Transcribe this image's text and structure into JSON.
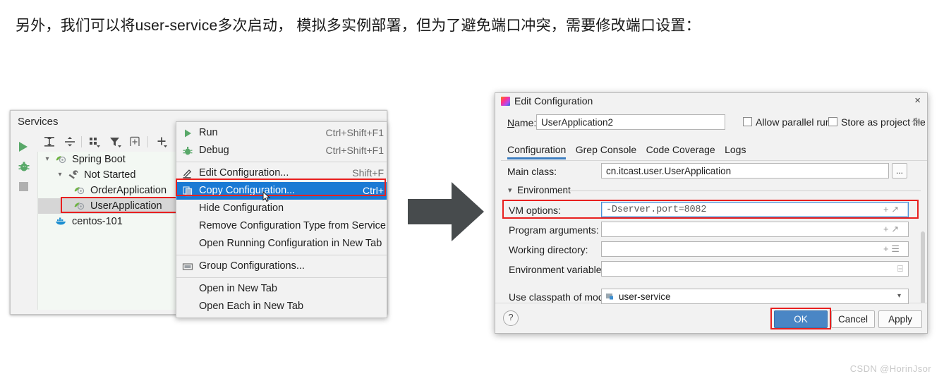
{
  "intro": {
    "text": "另外，我们可以将user-service多次启动， 模拟多实例部署，但为了避免端口冲突，需要修改端口设置："
  },
  "services_panel": {
    "title": "Services",
    "side_toolbar": [
      {
        "name": "run-icon",
        "label": "Run"
      },
      {
        "name": "debug-icon",
        "label": "Debug"
      },
      {
        "name": "stop-icon",
        "label": "Stop"
      }
    ],
    "toolbar": [
      {
        "name": "expand-all-icon",
        "label": "Expand All"
      },
      {
        "name": "collapse-all-icon",
        "label": "Collapse All"
      },
      {
        "name": "group-icon",
        "label": "Group"
      },
      {
        "name": "filter-icon",
        "label": "Filter"
      },
      {
        "name": "new-tab-icon",
        "label": "Open in New Tab"
      },
      {
        "name": "add-icon",
        "label": "Add Service"
      }
    ],
    "tree": [
      {
        "label": "Spring Boot",
        "icon": "spring-leaf-icon",
        "indent": 0,
        "chevron": "v",
        "selected": false
      },
      {
        "label": "Not Started",
        "icon": "wrench-icon",
        "indent": 1,
        "chevron": "v",
        "selected": false
      },
      {
        "label": "OrderApplication",
        "icon": "spring-leaf-icon",
        "indent": 2,
        "chevron": "",
        "selected": false
      },
      {
        "label": "UserApplication",
        "icon": "spring-leaf-icon",
        "indent": 2,
        "chevron": "",
        "selected": true
      },
      {
        "label": "centos-101",
        "icon": "docker-icon",
        "indent": 0,
        "chevron": "",
        "selected": false
      }
    ]
  },
  "context_menu": {
    "items": [
      {
        "label": "Run",
        "shortcut": "Ctrl+Shift+F1",
        "icon": "run-icon",
        "highlight": false,
        "separator_after": false
      },
      {
        "label": "Debug",
        "shortcut": "Ctrl+Shift+F1",
        "icon": "debug-icon",
        "highlight": false,
        "separator_after": true
      },
      {
        "label": "Edit Configuration...",
        "shortcut": "Shift+F",
        "icon": "pencil-icon",
        "highlight": false,
        "separator_after": false
      },
      {
        "label": "Copy Configuration...",
        "shortcut": "Ctrl+",
        "icon": "copy-icon",
        "highlight": true,
        "separator_after": false
      },
      {
        "label": "Hide Configuration",
        "shortcut": "",
        "icon": "",
        "highlight": false,
        "separator_after": false
      },
      {
        "label": "Remove Configuration Type from Service",
        "shortcut": "",
        "icon": "",
        "highlight": false,
        "separator_after": false
      },
      {
        "label": "Open Running Configuration in New Tab",
        "shortcut": "",
        "icon": "",
        "highlight": false,
        "separator_after": true
      },
      {
        "label": "Group Configurations...",
        "shortcut": "",
        "icon": "folder-icon",
        "highlight": false,
        "separator_after": true
      },
      {
        "label": "Open in New Tab",
        "shortcut": "",
        "icon": "",
        "highlight": false,
        "separator_after": false
      },
      {
        "label": "Open Each in New Tab",
        "shortcut": "",
        "icon": "",
        "highlight": false,
        "separator_after": false
      }
    ]
  },
  "flow_arrow": {
    "name": "right-arrow",
    "color": "#474b4d"
  },
  "dialog": {
    "title": "Edit Configuration",
    "close_label": "×",
    "name_label": "Name:",
    "name_value": "UserApplication2",
    "checkboxes": [
      {
        "label": "Allow parallel run",
        "checked": false
      },
      {
        "label": "Store as project file",
        "checked": false
      }
    ],
    "tabs": [
      {
        "label": "Configuration",
        "active": true
      },
      {
        "label": "Grep Console",
        "active": false
      },
      {
        "label": "Code Coverage",
        "active": false
      },
      {
        "label": "Logs",
        "active": false
      }
    ],
    "fields": [
      {
        "label": "Main class:",
        "value": "cn.itcast.user.UserApplication",
        "adorn": "..."
      },
      {
        "label": "VM options:",
        "value": "-Dserver.port=8082",
        "adorn": "+ ↗"
      },
      {
        "label": "Program arguments:",
        "value": "",
        "adorn": "+ ↗"
      },
      {
        "label": "Working directory:",
        "value": "",
        "adorn": "+ ☰"
      },
      {
        "label": "Environment variables:",
        "value": "",
        "adorn": "⌸"
      }
    ],
    "environment_section_label": "Environment",
    "module_label": "Use classpath of module:",
    "module_value": "user-service",
    "help_label": "?",
    "buttons": [
      {
        "label": "OK",
        "primary": true
      },
      {
        "label": "Cancel",
        "primary": false
      },
      {
        "label": "Apply",
        "primary": false
      }
    ]
  },
  "watermark": {
    "text": "CSDN @HorinJsor"
  },
  "colors": {
    "highlight_blue": "#1a7ad4",
    "annotation_red": "#e8201f",
    "spring_green": "#59a869",
    "primary_button": "#4a86c5"
  }
}
